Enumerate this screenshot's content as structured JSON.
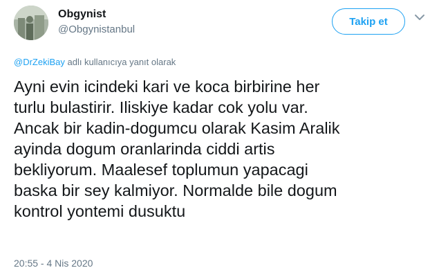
{
  "author": {
    "display_name": "Obgynist",
    "handle": "@Obgynistanbul",
    "avatar": "profile-photo"
  },
  "follow_button": {
    "label": "Takip et",
    "color": "#1da1f2"
  },
  "menu_icon": "chevron-down-icon",
  "reply_context": {
    "mention": "@DrZekiBay",
    "suffix": " adlı kullanıcıya yanıt olarak"
  },
  "tweet": {
    "text": "Ayni evin icindeki kari ve koca birbirine her\nturlu bulastirir. Iliskiye kadar cok yolu var.\nAncak bir kadin-dogumcu olarak Kasim Aralik\nayinda dogum oranlarinda ciddi artis\nbekliyorum. Maalesef toplumun yapacagi\nbaska bir sey kalmiyor. Normalde bile dogum\nkontrol yontemi dusuktu",
    "timestamp": "20:55 - 4 Nis 2020"
  },
  "colors": {
    "text": "#14171a",
    "secondary": "#657786",
    "accent": "#1da1f2"
  }
}
